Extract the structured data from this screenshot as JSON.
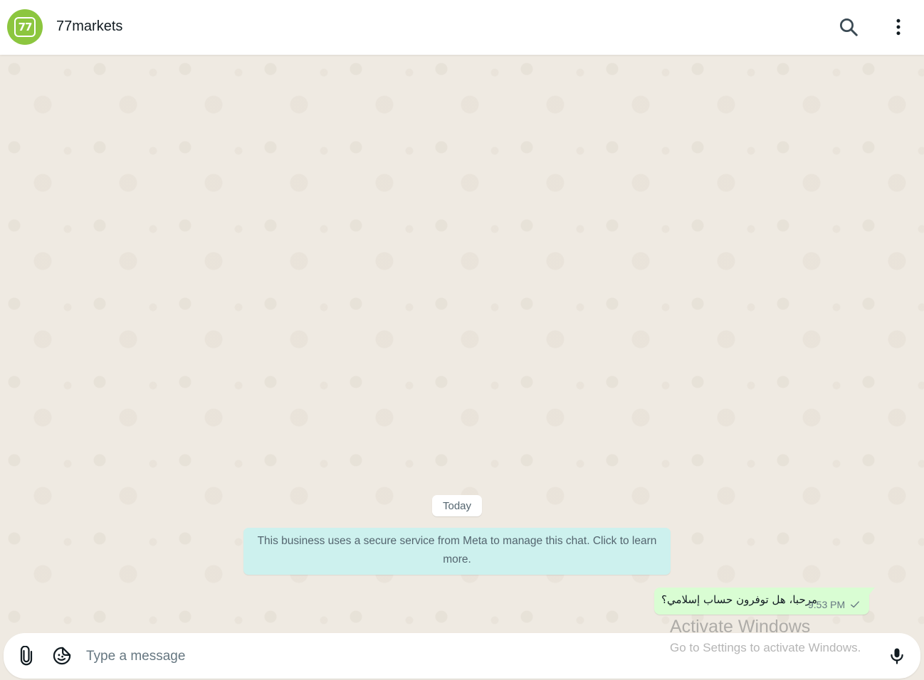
{
  "header": {
    "avatar_text": "77",
    "title": "77markets",
    "icons": {
      "search": "search-icon",
      "menu": "kebab-menu-icon"
    }
  },
  "chat": {
    "date_chip": "Today",
    "notice": "This business uses a secure service from Meta to manage this chat. Click to learn more.",
    "messages": [
      {
        "text": "مرحبا، هل توفرون حساب إسلامي؟",
        "time": "9:53 PM",
        "status": "sent",
        "status_icon": "single-check-icon"
      }
    ]
  },
  "composer": {
    "placeholder": "Type a message",
    "value": "",
    "icons": {
      "attach": "paperclip-icon",
      "sticker": "sticker-icon",
      "mic": "microphone-icon"
    }
  },
  "watermark": {
    "title": "Activate Windows",
    "subtitle": "Go to Settings to activate Windows."
  },
  "colors": {
    "brand": "#8cc63f",
    "chat_background": "#efeae2",
    "notice_background": "#cdf1ee",
    "outgoing_bubble": "#d9fdd3"
  }
}
